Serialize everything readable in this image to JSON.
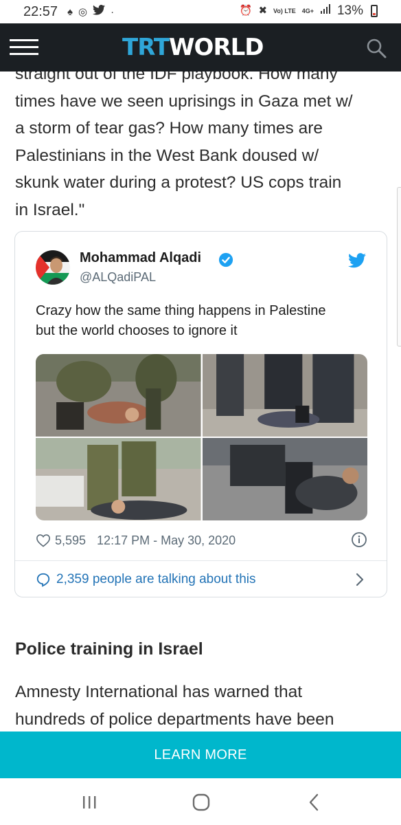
{
  "status_bar": {
    "time": "22:57",
    "network": "Vo) LTE",
    "network_type": "4G+",
    "battery": "13%"
  },
  "header": {
    "logo_part1": "TRT",
    "logo_part2": "WORLD",
    "icons": [
      "menu-icon",
      "search-icon"
    ]
  },
  "article": {
    "quote_lines": [
      "straight out of the IDF playbook. How many",
      "times have we seen uprisings in Gaza met w/",
      "a storm of tear gas? How many times are",
      "Palestinians in the West Bank doused w/",
      "skunk water during a protest? US cops train",
      "in Israel.\""
    ],
    "section_heading": "Police training in Israel",
    "body_lines": [
      "Amnesty International has warned that",
      "hundreds of police departments have been"
    ]
  },
  "tweet": {
    "author_name": "Mohammad Alqadi",
    "handle": "@ALQadiPAL",
    "text_lines": [
      "Crazy how the same thing happens in Palestine",
      "but the world chooses to ignore it"
    ],
    "likes": "5,595",
    "timestamp": "12:17 PM - May 30, 2020",
    "talking": "2,359 people are talking about this",
    "accent_color": "#1da1f2",
    "link_color": "#2273b6"
  },
  "cta": {
    "label": "LEARN MORE",
    "color": "#00b7cc"
  },
  "nav": {
    "icons": [
      "recents-icon",
      "home-icon",
      "back-icon"
    ]
  }
}
